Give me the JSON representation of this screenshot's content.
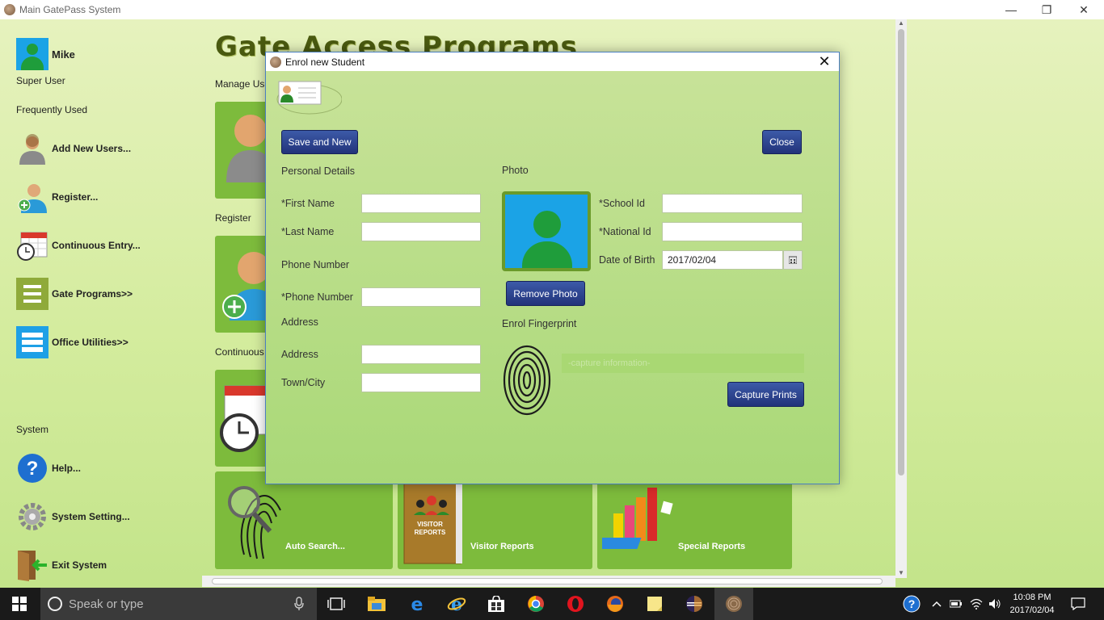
{
  "app_title": "Main GatePass System",
  "window_controls": {
    "minimize": "—",
    "restore": "❐",
    "close": "✕"
  },
  "user": {
    "name": "Mike",
    "role": "Super User"
  },
  "sidebar": {
    "frequently_used_label": "Frequently Used",
    "items": [
      {
        "label": "Add New Users...",
        "icon": "user-icon"
      },
      {
        "label": "Register...",
        "icon": "register-user-icon"
      },
      {
        "label": "Continuous Entry...",
        "icon": "calendar-clock-icon"
      },
      {
        "label": "Gate Programs>>",
        "icon": "list-icon"
      },
      {
        "label": "Office Utilities>>",
        "icon": "list-icon"
      }
    ],
    "system_label": "System",
    "system_items": [
      {
        "label": "Help...",
        "icon": "help-icon"
      },
      {
        "label": "System Setting...",
        "icon": "gear-icon"
      },
      {
        "label": "Exit System",
        "icon": "exit-door-icon"
      }
    ]
  },
  "content": {
    "title": "Gate Access Programs",
    "sections": [
      "Manage Use",
      "Register",
      "Continuous"
    ],
    "tiles": [
      {
        "label": "Auto Search...",
        "icon": "fingerprint-search-icon"
      },
      {
        "label": "Visitor Reports",
        "icon": "visitor-reports-icon"
      },
      {
        "label": "Special Reports",
        "icon": "chart-icon"
      }
    ]
  },
  "dialog": {
    "title": "Enrol new Student",
    "close_glyph": "✕",
    "save_new_label": "Save and New",
    "close_label": "Close",
    "personal_details_label": "Personal Details",
    "first_name_label": "*First Name",
    "first_name_value": "",
    "last_name_label": "*Last Name",
    "last_name_value": "",
    "phone_section_label": "Phone Number",
    "phone_label": "*Phone Number",
    "phone_value": "",
    "address_section_label": "Address",
    "address_label": "Address",
    "address_value": "",
    "town_label": "Town/City",
    "town_value": "",
    "photo_label": "Photo",
    "remove_photo_label": "Remove Photo",
    "school_id_label": "*School Id",
    "school_id_value": "",
    "national_id_label": "*National Id",
    "national_id_value": "",
    "dob_label": "Date of Birth",
    "dob_value": "2017/02/04",
    "fingerprint_label": "Enrol Fingerprint",
    "capture_info_placeholder": "-capture information-",
    "capture_prints_label": "Capture Prints"
  },
  "taskbar": {
    "search_placeholder": "Speak or type",
    "time": "10:08 PM",
    "date": "2017/02/04"
  },
  "colors": {
    "accent_blue": "#2b3f8f",
    "tile_green": "#7dbb3c",
    "photo_bg": "#1ba3e6",
    "photo_person": "#1f9d3b"
  }
}
